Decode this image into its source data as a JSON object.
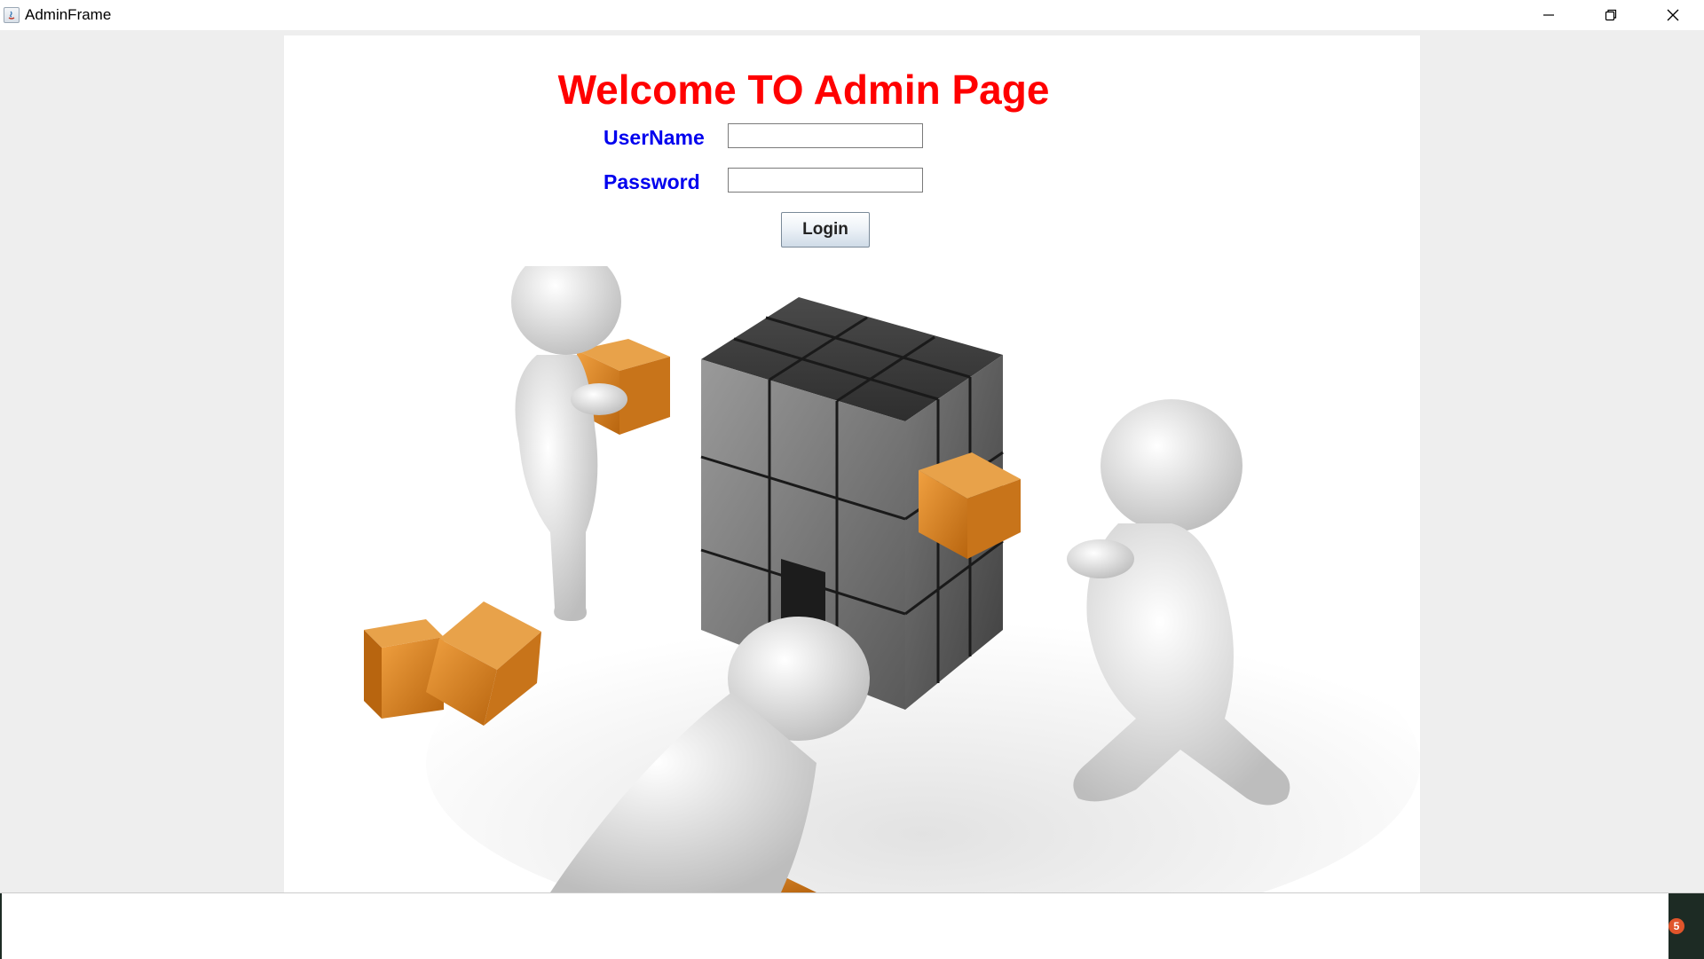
{
  "window": {
    "title": "AdminFrame",
    "controls": {
      "minimize_icon": "minimize-icon",
      "restore_icon": "restore-icon",
      "close_icon": "close-icon"
    }
  },
  "login": {
    "heading": "Welcome TO Admin Page",
    "username_label": "UserName",
    "username_value": "",
    "password_label": "Password",
    "password_value": "",
    "login_button": "Login"
  },
  "taskbar": {
    "badge": "5"
  },
  "colors": {
    "heading": "#ff0000",
    "labels": "#0000ee",
    "panel": "#ffffff",
    "frame_background": "#eeeeee",
    "cube_gray": "#555555",
    "cube_orange": "#d9821c"
  },
  "illustration": "3d-figures-building-cube-illustration"
}
